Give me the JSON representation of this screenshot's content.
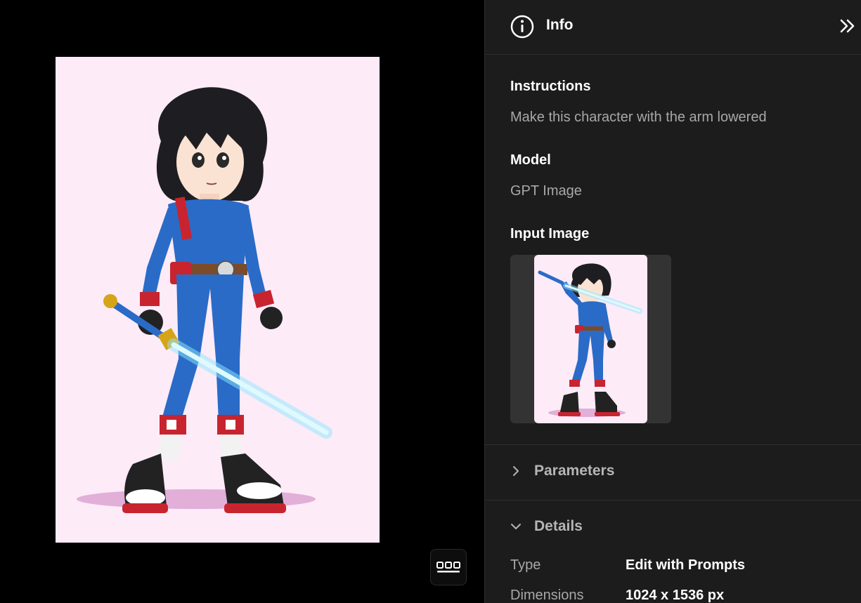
{
  "panel": {
    "title": "Info",
    "instructions_label": "Instructions",
    "instructions_value": "Make this character with the arm lowered",
    "model_label": "Model",
    "model_value": "GPT Image",
    "input_image_label": "Input Image"
  },
  "sections": {
    "parameters_label": "Parameters",
    "details_label": "Details"
  },
  "details": [
    {
      "key": "Type",
      "value": "Edit with Prompts"
    },
    {
      "key": "Dimensions",
      "value": "1024 x 1536 px"
    }
  ],
  "icons": {
    "info": "info-icon",
    "collapse": "double-chevron-right-icon",
    "gallery": "gallery-grid-icon",
    "chevron_right": "chevron-right-icon",
    "chevron_down": "chevron-down-icon"
  },
  "colors": {
    "panel_bg": "#1c1c1c",
    "viewer_bg": "#000000",
    "image_bg": "#fdebf8",
    "muted_text": "#a8a8a8"
  }
}
